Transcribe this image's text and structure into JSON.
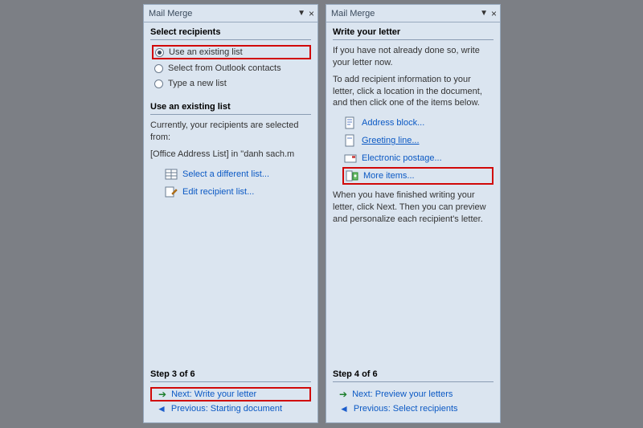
{
  "left": {
    "title": "Mail Merge",
    "header1": "Select recipients",
    "radios": [
      {
        "label": "Use an existing list",
        "selected": true
      },
      {
        "label": "Select from Outlook contacts",
        "selected": false
      },
      {
        "label": "Type a new list",
        "selected": false
      }
    ],
    "header2": "Use an existing list",
    "info1": "Currently, your recipients are selected from:",
    "info2": "[Office Address List] in \"danh sach.m",
    "links": [
      {
        "label": "Select a different list...",
        "icon": "table-icon"
      },
      {
        "label": "Edit recipient list...",
        "icon": "edit-icon"
      }
    ],
    "step": "Step 3 of 6",
    "next": "Next: Write your letter",
    "prev": "Previous: Starting document"
  },
  "right": {
    "title": "Mail Merge",
    "header1": "Write your letter",
    "para1": "If you have not already done so, write your letter now.",
    "para2": "To add recipient information to your letter, click a location in the document, and then click one of the items below.",
    "items": [
      {
        "label": "Address block...",
        "icon": "address-icon",
        "underline": false,
        "highlight": false
      },
      {
        "label": "Greeting line...",
        "icon": "greeting-icon",
        "underline": true,
        "highlight": false
      },
      {
        "label": "Electronic postage...",
        "icon": "postage-icon",
        "underline": false,
        "highlight": false
      },
      {
        "label": "More items...",
        "icon": "more-icon",
        "underline": false,
        "highlight": true
      }
    ],
    "para3": "When you have finished writing your letter, click Next. Then you can preview and personalize each recipient's letter.",
    "step": "Step 4 of 6",
    "next": "Next: Preview your letters",
    "prev": "Previous: Select recipients"
  }
}
